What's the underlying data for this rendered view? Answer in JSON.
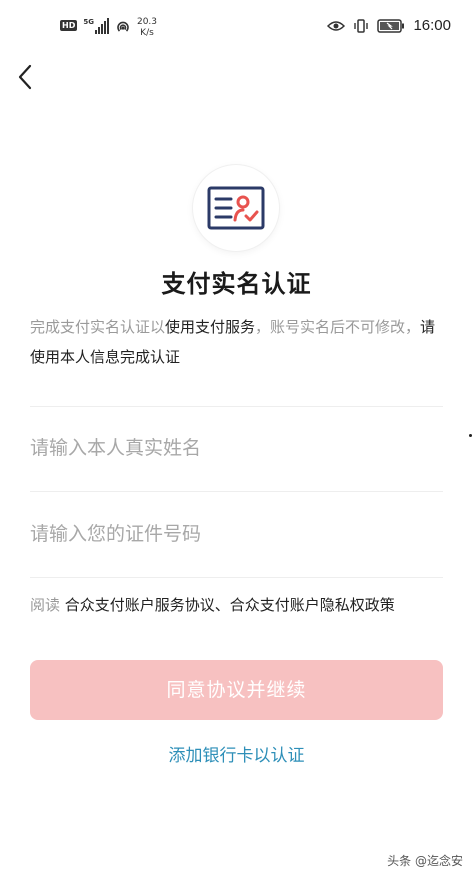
{
  "status_bar": {
    "hd": "HD",
    "network_gen": "5G",
    "speed_value": "20.3",
    "speed_unit": "K/s",
    "time": "16:00"
  },
  "page": {
    "title": "支付实名认证",
    "description": {
      "part1": "完成支付实名认证以",
      "part2": "使用支付服务",
      "part3": "，账号实名后不可修改，",
      "part4": "请使用本人信息完成认证"
    },
    "name_placeholder": "请输入本人真实姓名",
    "id_placeholder": "请输入您的证件号码",
    "agreement": {
      "prefix": "阅读",
      "links": "合众支付账户服务协议、合众支付账户隐私权政策"
    },
    "confirm_button": "同意协议并继续",
    "bank_link": "添加银行卡以认证"
  },
  "watermark": "头条 @迄念安",
  "colors": {
    "accent_red": "#e8534f",
    "icon_navy": "#2b3a67",
    "button_disabled": "#f7c1c1",
    "link_blue": "#2e8fb8"
  },
  "icons": [
    "back-arrow-icon",
    "id-card-verify-icon",
    "eye-icon",
    "vibrate-icon",
    "battery-icon",
    "hotspot-icon"
  ]
}
